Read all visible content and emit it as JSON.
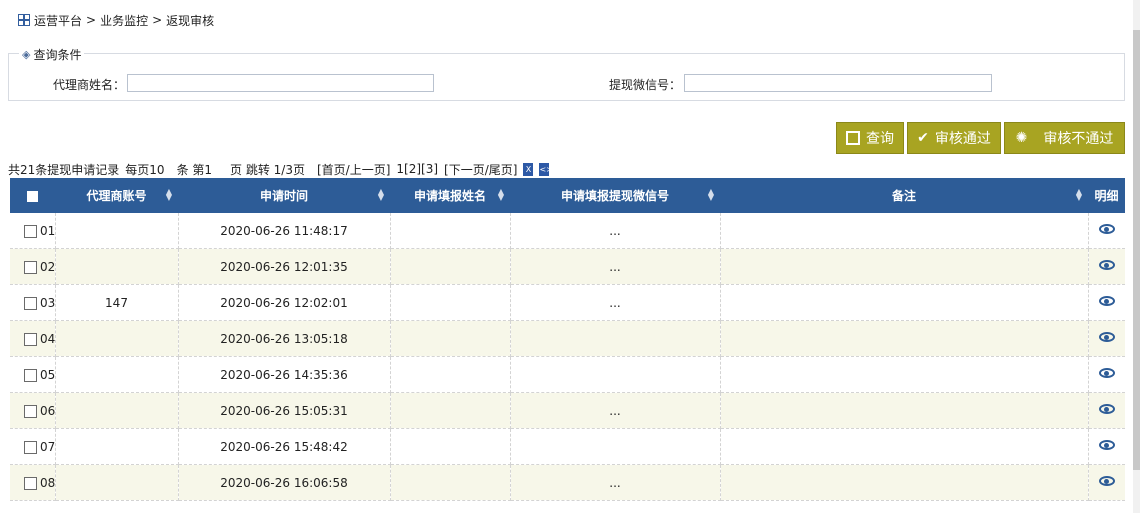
{
  "breadcrumb": {
    "root": "运营平台",
    "sep": ">",
    "section": "业务监控",
    "page": "返现审核"
  },
  "query": {
    "legend": "查询条件",
    "agent_name_label": "代理商姓名：",
    "agent_name_value": "",
    "wechat_label": "提现微信号：",
    "wechat_value": ""
  },
  "buttons": {
    "search": "查询",
    "approve": "审核通过",
    "reject": "审核不通过"
  },
  "pager": {
    "summary": "共21条提现申请记录",
    "per_page": "每页10",
    "item_unit": "条 第1",
    "jump": "页 跳转 1/3页",
    "nav_prev": "[首页/上一页]",
    "pages": "1[2][3]",
    "nav_next": "[下一页/尾页]"
  },
  "table": {
    "columns": [
      "代理商账号",
      "申请时间",
      "申请填报姓名",
      "申请填报提现微信号",
      "备注",
      "明细"
    ],
    "rows": [
      {
        "no": "01",
        "account": "",
        "time": "2020-06-26 11:48:17",
        "name": "",
        "wechat": "...",
        "remark": ""
      },
      {
        "no": "02",
        "account": "",
        "time": "2020-06-26 12:01:35",
        "name": "",
        "wechat": "...",
        "remark": ""
      },
      {
        "no": "03",
        "account": "147",
        "time": "2020-06-26 12:02:01",
        "name": "",
        "wechat": "...",
        "remark": ""
      },
      {
        "no": "04",
        "account": "",
        "time": "2020-06-26 13:05:18",
        "name": "",
        "wechat": "",
        "remark": ""
      },
      {
        "no": "05",
        "account": "",
        "time": "2020-06-26 14:35:36",
        "name": "",
        "wechat": "",
        "remark": ""
      },
      {
        "no": "06",
        "account": "",
        "time": "2020-06-26 15:05:31",
        "name": "",
        "wechat": "...",
        "remark": ""
      },
      {
        "no": "07",
        "account": "",
        "time": "2020-06-26 15:48:42",
        "name": "",
        "wechat": "",
        "remark": ""
      },
      {
        "no": "08",
        "account": "",
        "time": "2020-06-26 16:06:58",
        "name": "",
        "wechat": "...",
        "remark": ""
      }
    ]
  },
  "icons": {
    "breadcrumb": "grid-icon",
    "legend": "layers-icon",
    "detail": "eye-icon",
    "export_excel": "excel-icon",
    "export_xml": "xml-icon"
  },
  "colors": {
    "header": "#2d5c97",
    "button": "#a8a422",
    "alt_row": "#f7f7e9"
  }
}
